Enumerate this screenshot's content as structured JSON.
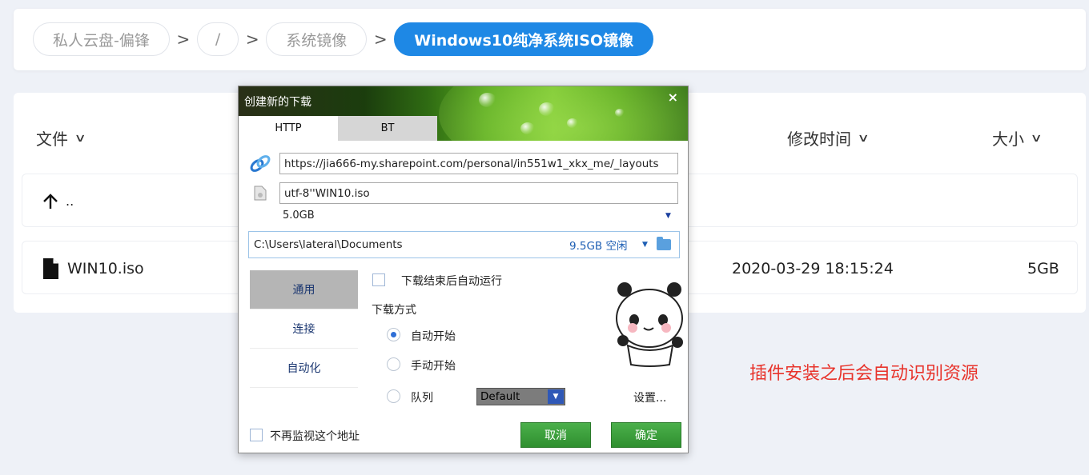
{
  "breadcrumb": {
    "items": [
      "私人云盘-偏锋",
      "/",
      "系统镜像"
    ],
    "current": "Windows10纯净系统ISO镜像",
    "separator": ">"
  },
  "list": {
    "columns": {
      "name": "文件",
      "modified": "修改时间",
      "size": "大小"
    },
    "parent_label": "..",
    "files": [
      {
        "name": "WIN10.iso",
        "modified": "2020-03-29 18:15:24",
        "size": "5GB"
      }
    ]
  },
  "annotation": "插件安装之后会自动识别资源",
  "dialog": {
    "title": "创建新的下载",
    "close": "×",
    "tabs": [
      "HTTP",
      "BT"
    ],
    "url": "https://jia666-my.sharepoint.com/personal/in551w1_xkx_me/_layouts",
    "filename": "utf-8''WIN10.iso",
    "filesize": "5.0GB",
    "path": "C:\\Users\\lateral\\Documents",
    "free_space": "9.5GB 空闲",
    "sidebar": [
      "通用",
      "连接",
      "自动化"
    ],
    "auto_run_label": "下载结束后自动运行",
    "mode_label": "下载方式",
    "modes": [
      "自动开始",
      "手动开始",
      "队列"
    ],
    "queue_value": "Default",
    "settings_label": "设置...",
    "no_monitor_label": "不再监视这个地址",
    "cancel": "取消",
    "ok": "确定",
    "accent": "#1e88e5",
    "button_color": "#3a9a3a"
  }
}
